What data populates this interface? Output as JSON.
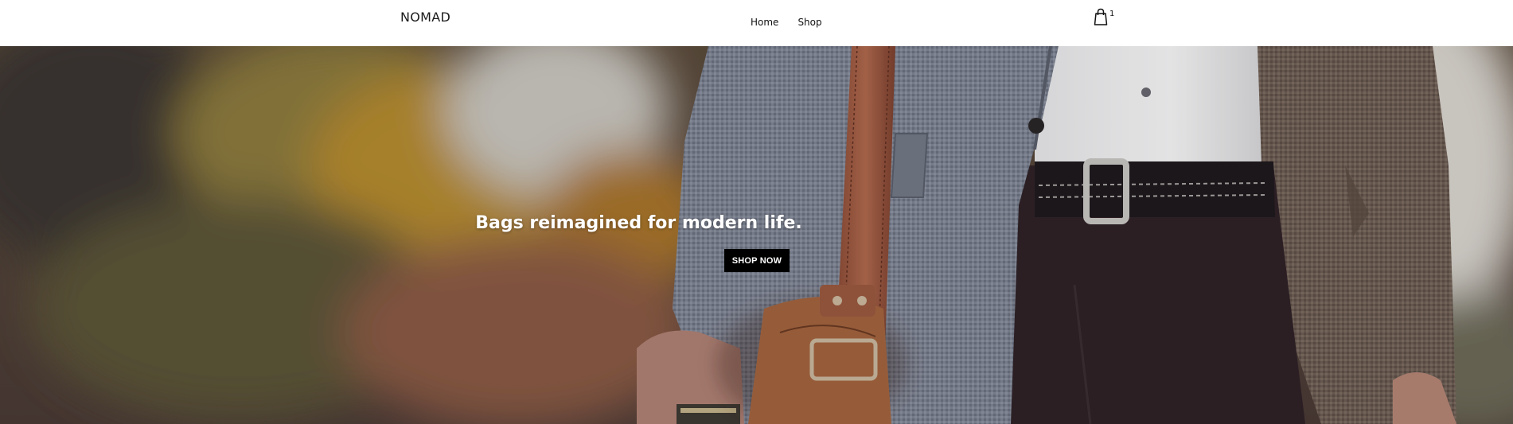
{
  "header": {
    "brand": "NOMAD",
    "nav": [
      {
        "label": "Home"
      },
      {
        "label": "Shop"
      }
    ],
    "cart": {
      "icon": "shopping-bag-icon",
      "count": "1"
    }
  },
  "hero": {
    "title": "Bags reimagined for modern life.",
    "cta_label": "SHOP NOW",
    "image": "photo of a man in a houndstooth blazer carrying a brown leather bag"
  },
  "colors": {
    "header_bg": "#ffffff",
    "text_dark": "#111111",
    "cta_bg": "#000000",
    "cta_text": "#ffffff",
    "hero_text": "#ffffff"
  }
}
